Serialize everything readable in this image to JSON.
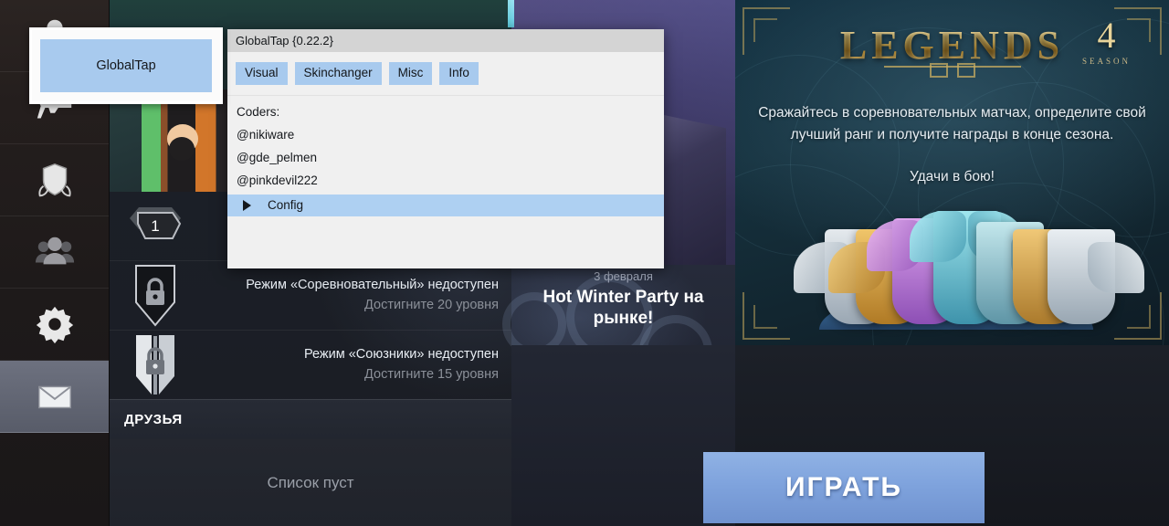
{
  "launcher": {
    "label": "GlobalTap"
  },
  "overlay": {
    "title": "GlobalTap {0.22.2}",
    "tabs": [
      {
        "label": "Visual"
      },
      {
        "label": "Skinchanger"
      },
      {
        "label": "Misc"
      },
      {
        "label": "Info"
      }
    ],
    "lines": [
      "Coders:",
      "@nikiware",
      "@gde_pelmen",
      "@pinkdevil222"
    ],
    "config_label": "Config",
    "accent_color": "#a8caee",
    "row_highlight_color": "#aed0f2",
    "titlebar_color": "#d4d4d4",
    "body_color": "#f0f0f0"
  },
  "sidebar": {
    "items": [
      {
        "name": "profile",
        "icon": "person-icon",
        "active": false
      },
      {
        "name": "loadout",
        "icon": "pistol-icon",
        "active": false
      },
      {
        "name": "ranked",
        "icon": "shield-laurel-icon",
        "active": false
      },
      {
        "name": "clan",
        "icon": "people-group-icon",
        "active": false
      },
      {
        "name": "settings",
        "icon": "gear-icon",
        "active": false
      },
      {
        "name": "mail",
        "icon": "envelope-icon",
        "active": true
      }
    ]
  },
  "profile": {
    "level": "1"
  },
  "modes": [
    {
      "badge": "lock-shield-dark",
      "title": "Режим «Соревновательный» недоступен",
      "requirement": "Достигните 20 уровня"
    },
    {
      "badge": "lock-shield-light",
      "title": "Режим «Союзники» недоступен",
      "requirement": "Достигните 15 уровня"
    }
  ],
  "friends": {
    "header": "ДРУЗЬЯ",
    "empty_text": "Список пуст"
  },
  "news": {
    "date": "3 февраля",
    "title": "Hot Winter Party на рынке!"
  },
  "banner": {
    "title": "LEGENDS",
    "season_number": "4",
    "season_label": "SEASON",
    "description": "Сражайтесь в соревновательных матчах, определите свой лучший ранг и получите награды в конце сезона.",
    "luck_line": "Удачи в бою!",
    "badge_colors": [
      "#cfd6dc",
      "#d9a23f",
      "#c58bd6",
      "#7ad3de",
      "#b5e0e6",
      "#d4a24a",
      "#d8dde2"
    ]
  },
  "play": {
    "label": "ИГРАТЬ",
    "color": "#7fa3dd"
  }
}
